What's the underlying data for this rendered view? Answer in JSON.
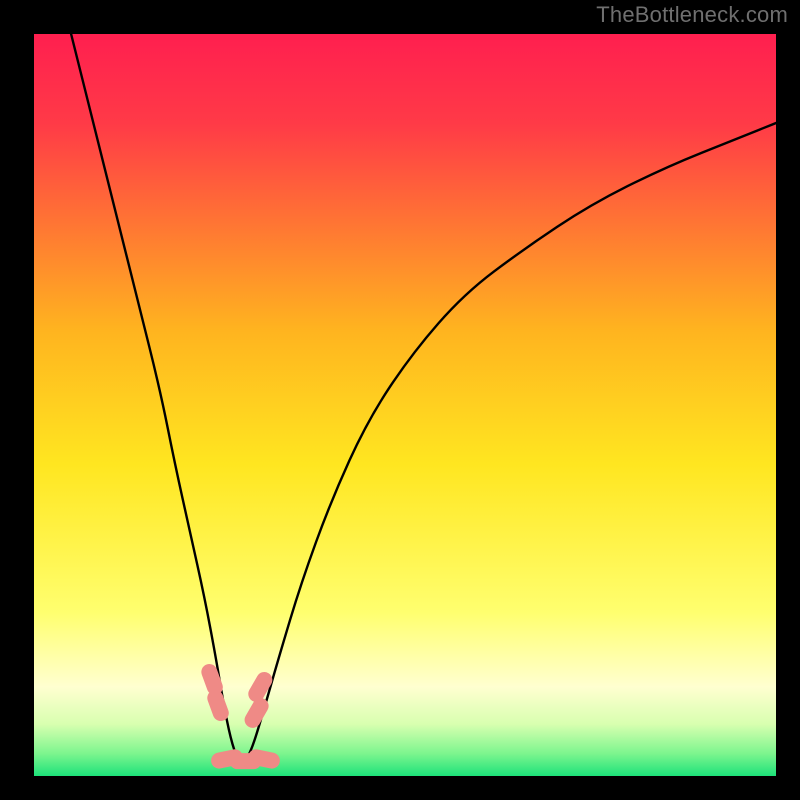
{
  "watermark": "TheBottleneck.com",
  "chart_data": {
    "type": "line",
    "title": "",
    "xlabel": "",
    "ylabel": "",
    "xlim": [
      0,
      100
    ],
    "ylim": [
      0,
      100
    ],
    "background_gradient": {
      "stops": [
        {
          "offset": 0.0,
          "color": "#ff1f4f"
        },
        {
          "offset": 0.12,
          "color": "#ff3a47"
        },
        {
          "offset": 0.4,
          "color": "#ffb41f"
        },
        {
          "offset": 0.58,
          "color": "#ffe620"
        },
        {
          "offset": 0.78,
          "color": "#ffff6f"
        },
        {
          "offset": 0.88,
          "color": "#ffffd0"
        },
        {
          "offset": 0.93,
          "color": "#d8ffb0"
        },
        {
          "offset": 0.97,
          "color": "#7cf58e"
        },
        {
          "offset": 1.0,
          "color": "#1de27a"
        }
      ]
    },
    "series": [
      {
        "name": "bottleneck-curve",
        "color": "#000000",
        "x": [
          5,
          8,
          11,
          14,
          17,
          19,
          21,
          23,
          24.5,
          25.5,
          26.5,
          27.5,
          28.5,
          29.5,
          31,
          33,
          36,
          40,
          45,
          51,
          58,
          66,
          75,
          85,
          95,
          100
        ],
        "values": [
          100,
          88,
          76,
          64,
          52,
          42,
          33,
          24,
          16,
          10,
          5,
          2,
          2,
          4,
          9,
          16,
          26,
          37,
          48,
          57,
          65,
          71,
          77,
          82,
          86,
          88
        ]
      }
    ],
    "markers": [
      {
        "name": "marker-left-upper",
        "x": 24.0,
        "y": 13.0,
        "color": "#ef8a86"
      },
      {
        "name": "marker-left-lower",
        "x": 24.8,
        "y": 9.5,
        "color": "#ef8a86"
      },
      {
        "name": "marker-right-upper",
        "x": 30.5,
        "y": 12.0,
        "color": "#ef8a86"
      },
      {
        "name": "marker-right-lower",
        "x": 30.0,
        "y": 8.5,
        "color": "#ef8a86"
      },
      {
        "name": "marker-bottom-left",
        "x": 26.0,
        "y": 2.3,
        "color": "#ef8a86"
      },
      {
        "name": "marker-bottom-mid",
        "x": 28.5,
        "y": 2.0,
        "color": "#ef8a86"
      },
      {
        "name": "marker-bottom-right",
        "x": 31.0,
        "y": 2.3,
        "color": "#ef8a86"
      }
    ]
  }
}
